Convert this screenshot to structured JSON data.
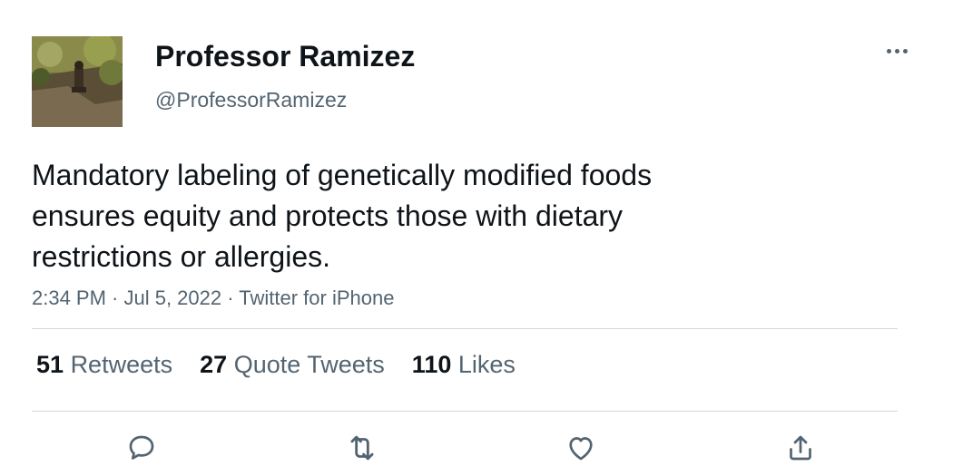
{
  "profile": {
    "name": "Professor Ramizez",
    "handle": "@ProfessorRamizez",
    "avatar_icon": "avatar-photo"
  },
  "more_icon": "more-horizontal-icon",
  "tweet": {
    "lines": [
      "Mandatory labeling of genetically modified foods",
      "ensures equity and protects those with dietary",
      "restrictions or allergies."
    ],
    "meta": "2:34 PM · Jul 5, 2022 · Twitter for iPhone"
  },
  "stats": {
    "retweets": {
      "count": "51",
      "label": "Retweets"
    },
    "quotes": {
      "count": "27",
      "label": "Quote Tweets"
    },
    "likes": {
      "count": "110",
      "label": "Likes"
    }
  },
  "actions": [
    {
      "icon": "reply-icon"
    },
    {
      "icon": "retweet-icon"
    },
    {
      "icon": "like-icon"
    },
    {
      "icon": "share-icon"
    }
  ],
  "colors": {
    "text": "#0f1419",
    "secondary": "#536471",
    "divider": "#cfd9de"
  }
}
